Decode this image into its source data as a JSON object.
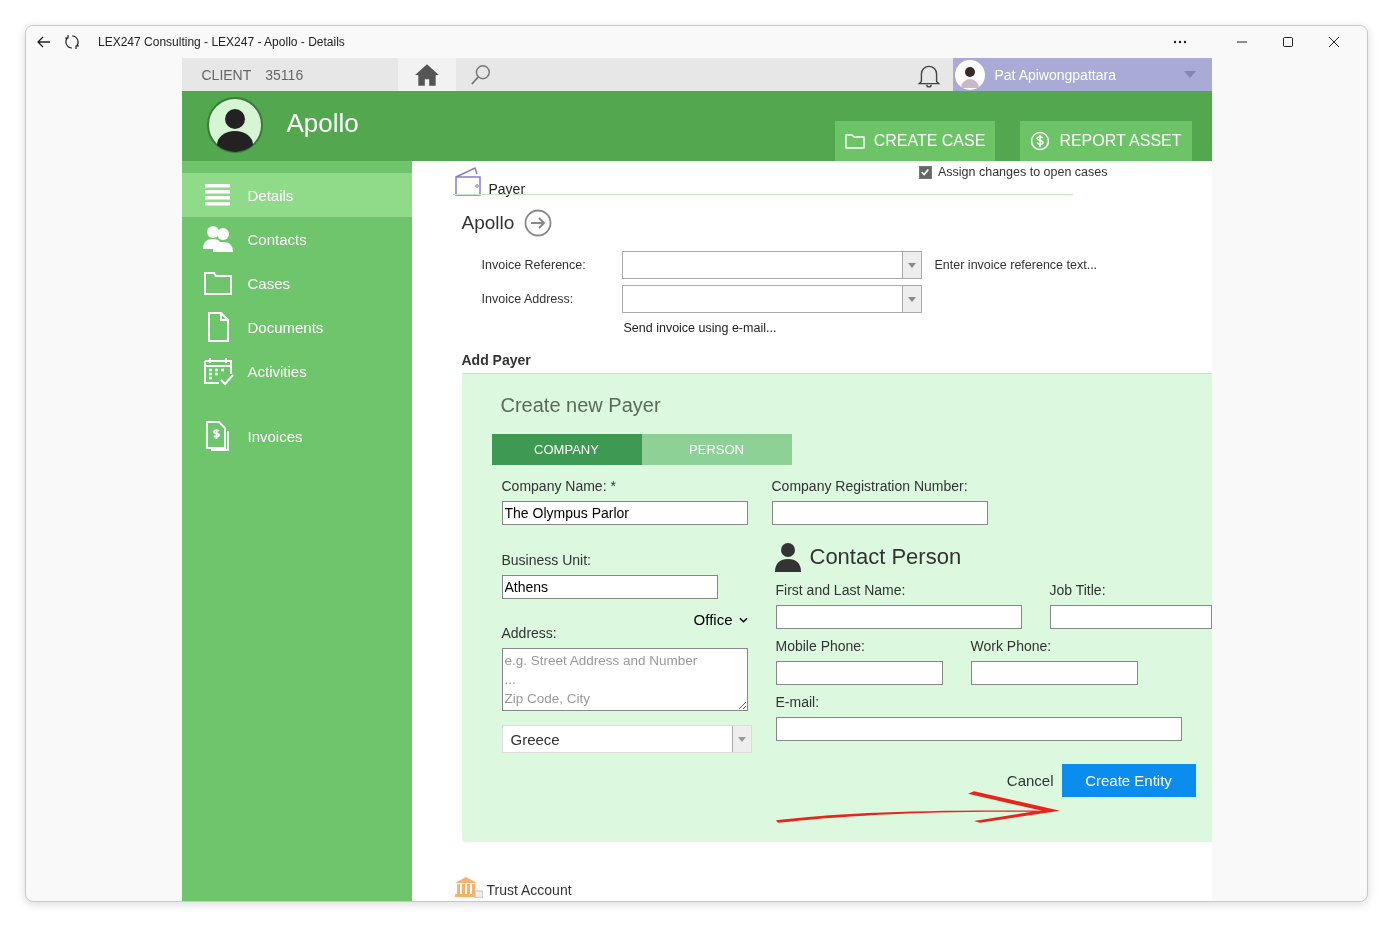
{
  "window": {
    "title": "LEX247 Consulting - LEX247 - Apollo - Details"
  },
  "topbar": {
    "client_label": "CLIENT",
    "client_number": "35116",
    "user_name": "Pat Apiwongpattara"
  },
  "header": {
    "title": "Apollo",
    "buttons": [
      {
        "label": "CREATE CASE",
        "kind": "folder"
      },
      {
        "label": "REPORT ASSET",
        "kind": "dollar"
      }
    ]
  },
  "sidebar": {
    "items": [
      {
        "label": "Details",
        "kind": "list",
        "selected": true
      },
      {
        "label": "Contacts",
        "kind": "people",
        "selected": false
      },
      {
        "label": "Cases",
        "kind": "folder",
        "selected": false
      },
      {
        "label": "Documents",
        "kind": "document",
        "selected": false
      },
      {
        "label": "Activities",
        "kind": "calendar",
        "selected": false
      },
      {
        "label": "Invoices",
        "kind": "invoice",
        "selected": false
      }
    ]
  },
  "assign_changes": {
    "label": "Assign changes to open cases",
    "checked": true
  },
  "payer": {
    "section_title": "Payer",
    "name": "Apollo",
    "invoice_reference": {
      "label": "Invoice Reference:",
      "hint": "Enter invoice reference text..."
    },
    "invoice_address": {
      "label": "Invoice Address:"
    },
    "email_link": "Send invoice using e-mail..."
  },
  "add_payer": {
    "title": "Add Payer",
    "form_title": "Create new Payer",
    "tabs": [
      {
        "label": "COMPANY",
        "selected": true
      },
      {
        "label": "PERSON",
        "selected": false
      }
    ],
    "company_name": {
      "label": "Company Name: *",
      "value": "The Olympus Parlor"
    },
    "registration_number": {
      "label": "Company Registration Number:"
    },
    "business_unit": {
      "label": "Business Unit:",
      "value": "Athens"
    },
    "address": {
      "label": "Address:",
      "type": "Office",
      "placeholder": "e.g. Street Address and Number\n...\nZip Code, City",
      "country": "Greece"
    },
    "contact": {
      "title": "Contact Person",
      "name_label": "First and Last Name:",
      "job_label": "Job Title:",
      "mobile_label": "Mobile Phone:",
      "work_label": "Work Phone:",
      "email_label": "E-mail:"
    },
    "cancel": "Cancel",
    "submit": "Create Entity"
  },
  "next_section": {
    "title": "Trust Account"
  }
}
